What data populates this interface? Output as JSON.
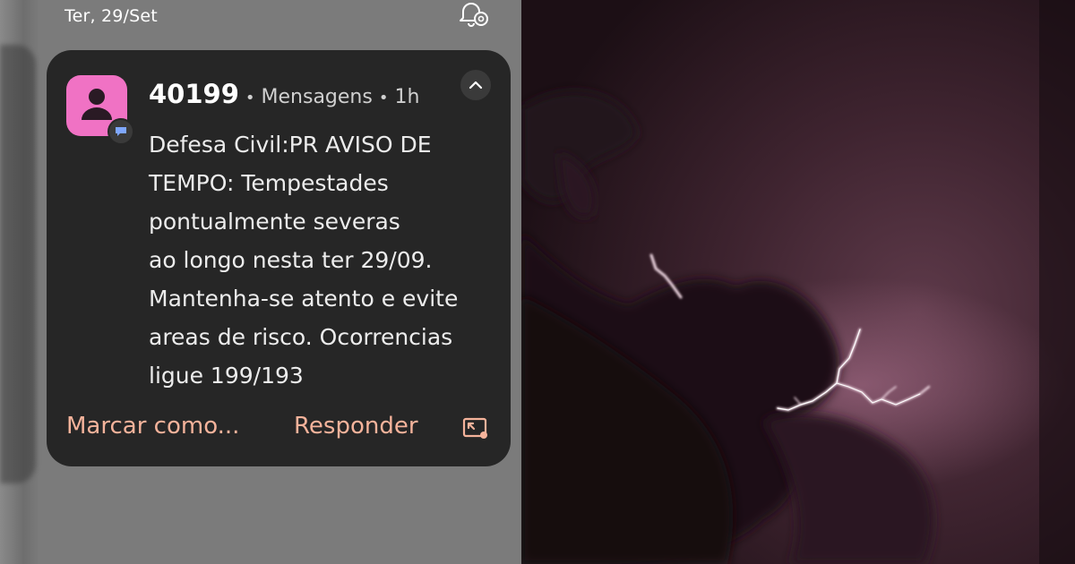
{
  "status_bar": {
    "date": "Ter, 29/Set"
  },
  "notification": {
    "sender": "40199",
    "app_name": "Mensagens",
    "time_ago": "1h",
    "separator": "•",
    "body_lines": [
      "Defesa Civil:PR AVISO DE",
      "TEMPO: Tempestades",
      "pontualmente severas",
      "ao longo nesta ter 29/09.",
      "Mantenha-se atento e evite",
      "areas de risco. Ocorrencias",
      "ligue 199/193"
    ],
    "actions": {
      "mark_label": "Marcar como...",
      "reply_label": "Responder"
    },
    "icons": {
      "app": "contact-avatar-icon",
      "badge": "message-bubble-icon",
      "collapse": "chevron-up-icon",
      "expand": "open-in-app-icon",
      "settings": "notification-settings-icon"
    }
  },
  "colors": {
    "card_background": "#262626",
    "avatar_pink": "#f072c4",
    "action_accent": "#f5b39b",
    "panel_gray": "#7b7b7b",
    "sky_dark": "#1a0e12",
    "lightning": "#f3dbe6"
  }
}
